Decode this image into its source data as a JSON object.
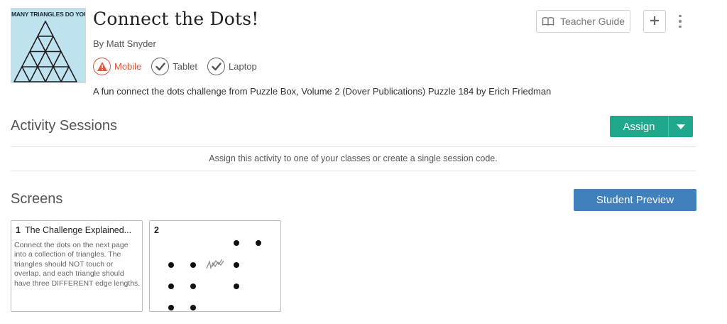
{
  "activity": {
    "thumbnail_caption": "MANY TRIANGLES DO YOU",
    "title": "Connect the Dots!",
    "author": "By Matt Snyder",
    "description": "A fun connect the dots challenge from Puzzle Box, Volume 2 (Dover Publications) Puzzle 184 by Erich Friedman",
    "devices": [
      {
        "label": "Mobile",
        "icon": "warning-icon",
        "status": "warning"
      },
      {
        "label": "Tablet",
        "icon": "check-icon",
        "status": "supported"
      },
      {
        "label": "Laptop",
        "icon": "check-icon",
        "status": "supported"
      }
    ]
  },
  "header_actions": {
    "teacher_guide_label": "Teacher Guide",
    "teacher_guide_icon": "book-icon",
    "add_icon": "plus-icon",
    "more_icon": "kebab-menu-icon"
  },
  "sessions": {
    "title": "Activity Sessions",
    "assign_label": "Assign",
    "message": "Assign this activity to one of your classes or create a single session code."
  },
  "screens": {
    "title": "Screens",
    "preview_label": "Student Preview",
    "cards": [
      {
        "number": "1",
        "title": "The Challenge Explained...",
        "text": "Connect the dots on the next page into a collection of triangles.  The triangles should NOT touch or overlap, and each triangle should have three DIFFERENT edge lengths."
      },
      {
        "number": "2",
        "title": "",
        "text": ""
      }
    ]
  },
  "colors": {
    "assign_green": "#1fa88c",
    "preview_blue": "#3f80bd",
    "warning_orange": "#e4573d",
    "thumbnail_bg": "#bfe3ee"
  }
}
